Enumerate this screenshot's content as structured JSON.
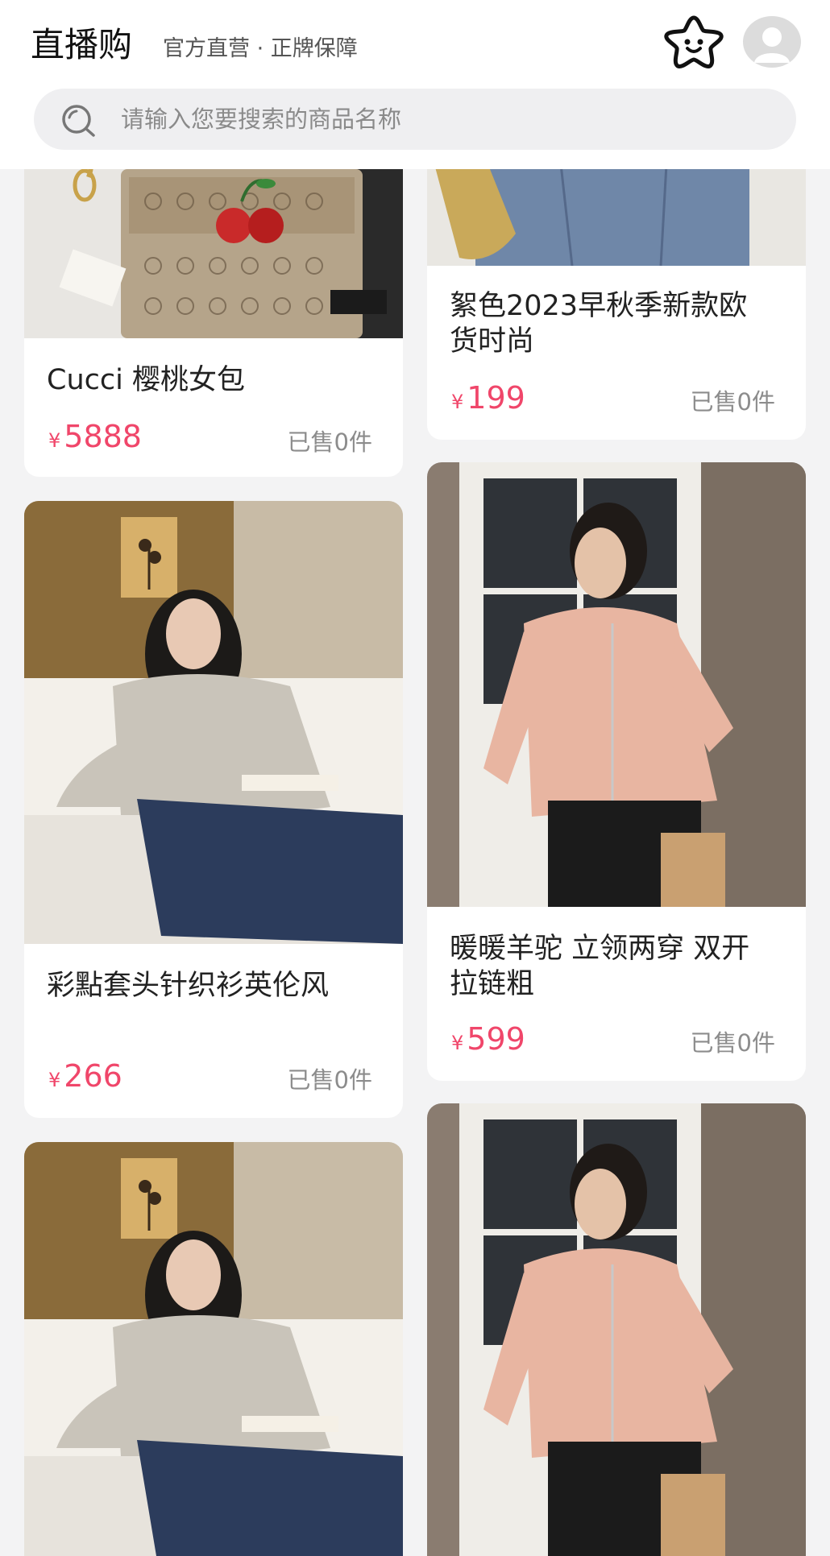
{
  "header": {
    "brand": "直播购",
    "tagline": "官方直营 · 正牌保障",
    "search_placeholder": "请输入您要搜索的商品名称"
  },
  "icons": {
    "star": "star-face-icon",
    "avatar": "user-avatar-icon",
    "search": "search-icon"
  },
  "colors": {
    "price": "#f0466a",
    "sold": "#8c8c8c",
    "background": "#f3f3f4"
  },
  "products": [
    {
      "title": "Cucci 樱桃女包",
      "currency": "¥",
      "price": "5888",
      "sold": "已售0件"
    },
    {
      "title": "絮色2023早秋季新款欧货时尚",
      "currency": "¥",
      "price": "199",
      "sold": "已售0件"
    },
    {
      "title": "彩點套头针织衫英伦风",
      "currency": "¥",
      "price": "266",
      "sold": "已售0件"
    },
    {
      "title": "暖暖羊驼 立领两穿 双开拉链粗",
      "currency": "¥",
      "price": "599",
      "sold": "已售0件"
    }
  ]
}
